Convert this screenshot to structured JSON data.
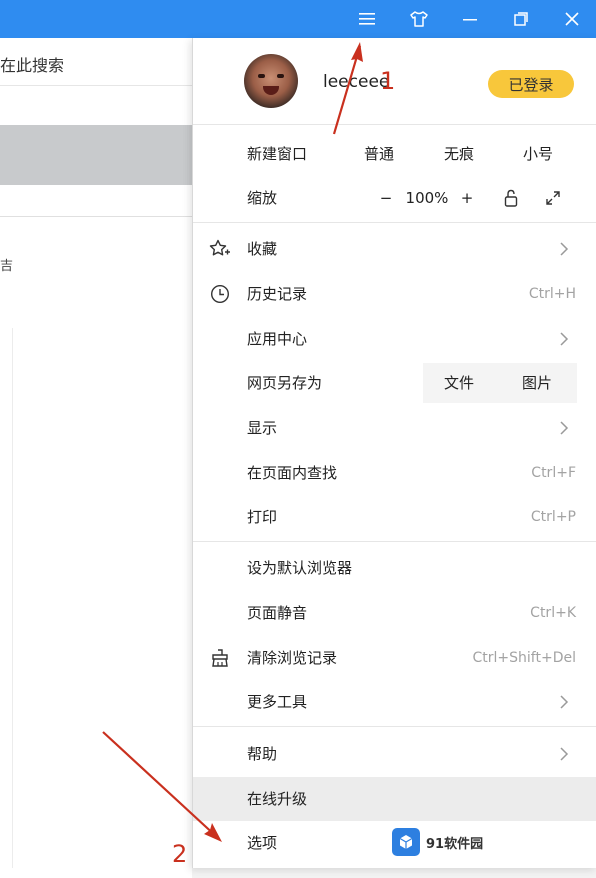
{
  "titlebar": {
    "icons": [
      "menu-icon",
      "skin-icon",
      "minimize-icon",
      "restore-icon",
      "close-icon"
    ],
    "color": "#2f8cf0"
  },
  "background": {
    "search_text": "在此搜索",
    "fragment_text": "吉"
  },
  "menu": {
    "user": {
      "name": "leeceee",
      "login_badge": "已登录"
    },
    "new_window": {
      "label": "新建窗口",
      "options": [
        "普通",
        "无痕",
        "小号"
      ]
    },
    "zoom": {
      "label": "缩放",
      "minus": "−",
      "value": "100%",
      "plus": "+"
    },
    "items": {
      "favorites": "收藏",
      "history": {
        "label": "历史记录",
        "shortcut": "Ctrl+H"
      },
      "app_center": "应用中心",
      "save_page": {
        "label": "网页另存为",
        "file": "文件",
        "image": "图片"
      },
      "display": "显示",
      "find": {
        "label": "在页面内查找",
        "shortcut": "Ctrl+F"
      },
      "print": {
        "label": "打印",
        "shortcut": "Ctrl+P"
      },
      "set_default": "设为默认浏览器",
      "mute": {
        "label": "页面静音",
        "shortcut": "Ctrl+K"
      },
      "clear_history": {
        "label": "清除浏览记录",
        "shortcut": "Ctrl+Shift+Del"
      },
      "more_tools": "更多工具",
      "help": "帮助",
      "upgrade": "在线升级",
      "options": "选项"
    }
  },
  "annotations": {
    "one": "1",
    "two": "2"
  },
  "watermark": {
    "text": "91软件园"
  },
  "colors": {
    "badge": "#f8c73b",
    "annotation": "#c9301e",
    "highlight": "#ececec"
  }
}
